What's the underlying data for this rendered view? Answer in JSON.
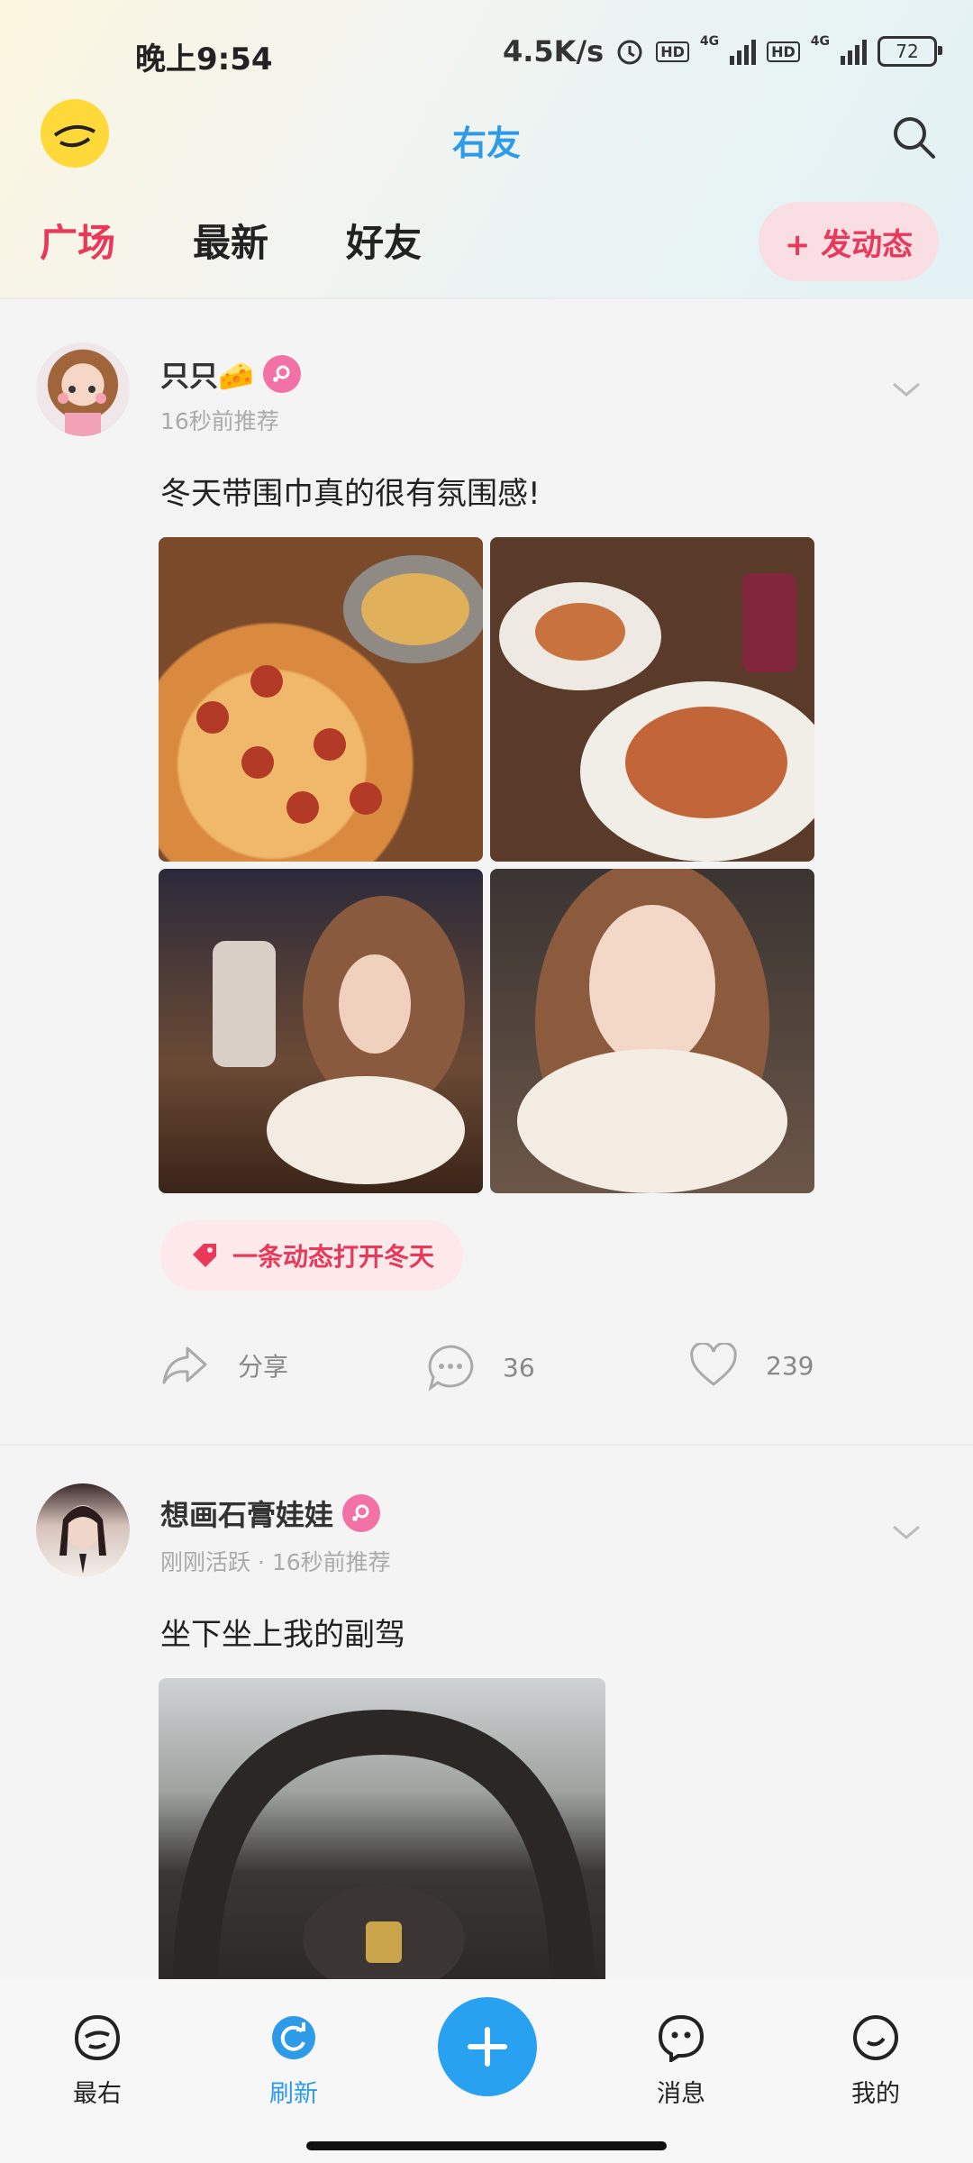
{
  "status_bar": {
    "time": "晚上9:54",
    "net_speed": "4.5K/s",
    "hd1": "HD",
    "net1": "4G",
    "hd2": "HD",
    "net2": "4G",
    "battery": "72"
  },
  "app_bar": {
    "title": "右友"
  },
  "tabs": [
    {
      "label": "广场",
      "active": true
    },
    {
      "label": "最新",
      "active": false
    },
    {
      "label": "好友",
      "active": false
    }
  ],
  "post_button": {
    "label": "+ 发动态"
  },
  "posts": [
    {
      "username": "只只🧀",
      "meta": "16秒前推荐",
      "content": "冬天带围巾真的很有氛围感!",
      "tag": "一条动态打开冬天",
      "share_label": "分享",
      "comments": "36",
      "likes": "239"
    },
    {
      "username": "想画石膏娃娃",
      "meta": "刚刚活跃 · 16秒前推荐",
      "content": "坐下坐上我的副驾"
    }
  ],
  "bottom_nav": [
    {
      "label": "最右"
    },
    {
      "label": "刷新"
    },
    {
      "label": "消息"
    },
    {
      "label": "我的"
    }
  ],
  "colors": {
    "accent_blue": "#2d9be8",
    "accent_pink": "#e8395b",
    "tag_bg": "#fde8ea"
  }
}
